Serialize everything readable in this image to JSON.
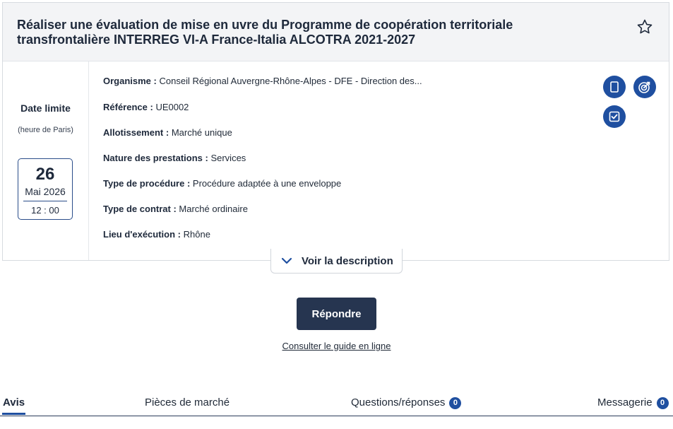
{
  "title": "Réaliser une évaluation de mise en uvre du Programme de coopération territoriale transfrontalière INTERREG VI-A France-Italia ALCOTRA 2021-2027",
  "deadline": {
    "label": "Date limite",
    "sublabel": "(heure de Paris)",
    "day": "26",
    "month_year": "Mai 2026",
    "time": "12 : 00"
  },
  "fields": [
    {
      "label": "Organisme :",
      "value": "Conseil Régional Auvergne-Rhône-Alpes - DFE - Direction des..."
    },
    {
      "label": "Référence :",
      "value": "UE0002"
    },
    {
      "label": "Allotissement :",
      "value": "Marché unique"
    },
    {
      "label": "Nature des prestations :",
      "value": "Services"
    },
    {
      "label": "Type de procédure :",
      "value": "Procédure adaptée à une enveloppe"
    },
    {
      "label": "Type de contrat :",
      "value": "Marché ordinaire"
    },
    {
      "label": "Lieu d'exécution :",
      "value": "Rhône"
    }
  ],
  "icons": [
    "star-icon",
    "document-icon",
    "target-icon",
    "checkbox-icon",
    "chevron-down-icon"
  ],
  "voir_description": "Voir la description",
  "primary_button": "Répondre",
  "guide_link": "Consulter le guide en ligne",
  "tabs": [
    {
      "label": "Avis",
      "active": true
    },
    {
      "label": "Pièces de marché"
    },
    {
      "label": "Questions/réponses",
      "badge": "0"
    },
    {
      "label": "Messagerie",
      "badge": "0"
    }
  ],
  "colors": {
    "accent": "#1f4fa0",
    "button": "#263550",
    "header_bg": "#f3f4f6"
  }
}
